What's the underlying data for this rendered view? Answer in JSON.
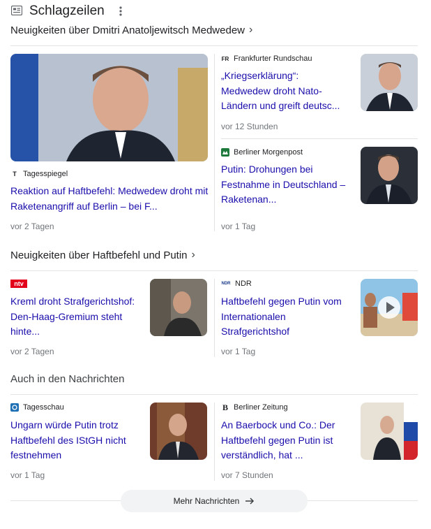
{
  "header": {
    "title": "Schlagzeilen"
  },
  "sections": [
    {
      "title": "Neuigkeiten über Dmitri Anatoljewitsch Medwedew"
    },
    {
      "title": "Neuigkeiten über Haftbefehl und Putin"
    },
    {
      "title": "Auch in den Nachrichten"
    }
  ],
  "articles": [
    {
      "source": "Tagesspiegel",
      "title": "Reaktion auf Haftbefehl: Medwedew droht mit Raketenangriff auf Berlin – bei F...",
      "time": "vor 2 Tagen"
    },
    {
      "source": "Frankfurter Rundschau",
      "title": "„Kriegserklärung“: Medwedew droht Nato-Ländern und greift deutsc...",
      "time": "vor 12 Stunden"
    },
    {
      "source": "Berliner Morgenpost",
      "title": "Putin: Drohungen bei Festnahme in Deutschland – Raketenan...",
      "time": "vor 1 Tag"
    },
    {
      "source": "",
      "title": "Kreml droht Strafgerichtshof: Den-Haag-Gremium steht hinte...",
      "time": "vor 2 Tagen"
    },
    {
      "source": "NDR",
      "title": "Haftbefehl gegen Putin vom Internationalen Strafgerichtshof",
      "time": "vor 1 Tag"
    },
    {
      "source": "Tagesschau",
      "title": "Ungarn würde Putin trotz Haftbefehl des IStGH nicht festnehmen",
      "time": "vor 1 Tag"
    },
    {
      "source": "Berliner Zeitung",
      "title": "An Baerbock und Co.: Der Haftbefehl gegen Putin ist verständlich, hat ...",
      "time": "vor 7 Stunden"
    }
  ],
  "logos": {
    "tagesspiegel": "T",
    "fr": "FR",
    "ntv": "ntv",
    "ndr": "NDR",
    "bz": "B"
  },
  "more": {
    "label": "Mehr Nachrichten"
  }
}
